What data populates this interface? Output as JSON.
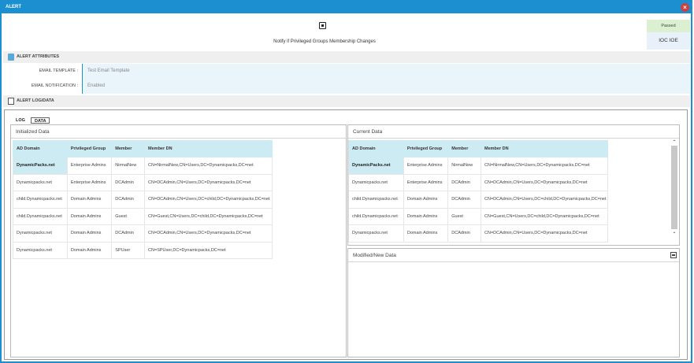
{
  "window": {
    "title": "ALERT",
    "close_glyph": "×"
  },
  "alert": {
    "title": "Notify if Privileged Groups Membership Changes",
    "icon": "alert-type-icon"
  },
  "status": {
    "passed": "Passed",
    "ioc": "IOC IOE"
  },
  "sections": {
    "attributes": "ALERT ATTRIBUTES",
    "log_data": "ALERT LOG/DATA"
  },
  "attributes": [
    {
      "label": "EMAIL TEMPLATE :",
      "value": "Test Email Template"
    },
    {
      "label": "EMAIL NOTIFICATION :",
      "value": "Enabled"
    }
  ],
  "tabs": [
    "LOG",
    "DATA"
  ],
  "initialized": {
    "title": "Initialized Data",
    "columns": [
      "AD Domain",
      "Privileged Group",
      "Member",
      "Member DN"
    ],
    "rows": [
      [
        "DynamicPacks.net",
        "Enterprise Admins",
        "NirmalNew",
        "CN=NirmalNew,CN=Users,DC=Dynamicpacks,DC=net"
      ],
      [
        "Dynamicpacks.net",
        "Enterprise Admins",
        "DCAdmin",
        "CN=DCAdmin,CN=Users,DC=Dynamicpacks,DC=net"
      ],
      [
        "child.Dynamicpacks.net",
        "Domain Admins",
        "DCAdmin",
        "CN=DCAdmin,CN=Users,DC=child,DC=Dynamicpacks,DC=net"
      ],
      [
        "child.Dynamicpacks.net",
        "Domain Admins",
        "Guest",
        "CN=Guest,CN=Users,DC=child,DC=Dynamicpacks,DC=net"
      ],
      [
        "Dynamicpacks.net",
        "Domain Admins",
        "DCAdmin",
        "CN=DCAdmin,CN=Users,DC=Dynamicpacks,DC=net"
      ],
      [
        "Dynamicpacks.net",
        "Domain Admins",
        "SPUser",
        "CN=SPUser,DC=Dynamicpacks,DC=net"
      ]
    ]
  },
  "current": {
    "title": "Current Data",
    "columns": [
      "AD Domain",
      "Privileged Group",
      "Member",
      "Member DN"
    ],
    "rows": [
      [
        "DynamicPacks.net",
        "Enterprise Admins",
        "NirmalNew",
        "CN=NirmalNew,CN=Users,DC=Dynamicpacks,DC=net"
      ],
      [
        "Dynamicpacks.net",
        "Enterprise Admins",
        "DCAdmin",
        "CN=DCAdmin,CN=Users,DC=Dynamicpacks,DC=net"
      ],
      [
        "child.Dynamicpacks.net",
        "Domain Admins",
        "DCAdmin",
        "CN=DCAdmin,CN=Users,DC=child,DC=Dynamicpacks,DC=net"
      ],
      [
        "child.Dynamicpacks.net",
        "Domain Admins",
        "Guest",
        "CN=Guest,CN=Users,DC=child,DC=Dynamicpacks,DC=net"
      ],
      [
        "Dynamicpacks.net",
        "Domain Admins",
        "DCAdmin",
        "CN=DCAdmin,CN=Users,DC=Dynamicpacks,DC=net"
      ]
    ]
  },
  "modified": {
    "title": "Modified/New Data"
  },
  "scroll": {
    "up": "⌃",
    "down": "⌄"
  },
  "colors": {
    "accent": "#1b8fd0",
    "header_cell": "#cdebf2",
    "passed": "#dbf0d0"
  }
}
